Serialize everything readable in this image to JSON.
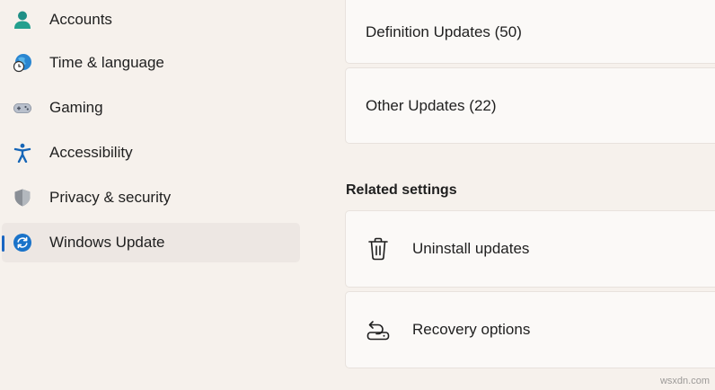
{
  "sidebar": {
    "items": [
      {
        "label": "Accounts",
        "icon": "account-icon",
        "active": false
      },
      {
        "label": "Time & language",
        "icon": "globe-clock-icon",
        "active": false
      },
      {
        "label": "Gaming",
        "icon": "gamepad-icon",
        "active": false
      },
      {
        "label": "Accessibility",
        "icon": "accessibility-icon",
        "active": false
      },
      {
        "label": "Privacy & security",
        "icon": "shield-icon",
        "active": false
      },
      {
        "label": "Windows Update",
        "icon": "sync-icon",
        "active": true
      }
    ]
  },
  "main": {
    "update_cards": [
      {
        "label": "Definition Updates (50)"
      },
      {
        "label": "Other Updates (22)"
      }
    ],
    "related_settings": {
      "title": "Related settings",
      "items": [
        {
          "label": "Uninstall updates",
          "icon": "trash-icon"
        },
        {
          "label": "Recovery options",
          "icon": "recovery-icon"
        }
      ]
    }
  },
  "watermark": "wsxdn.com",
  "colors": {
    "background": "#f6f1ec",
    "card": "#fbf9f7",
    "active_item": "#ede7e3",
    "accent": "#1a66c2"
  }
}
